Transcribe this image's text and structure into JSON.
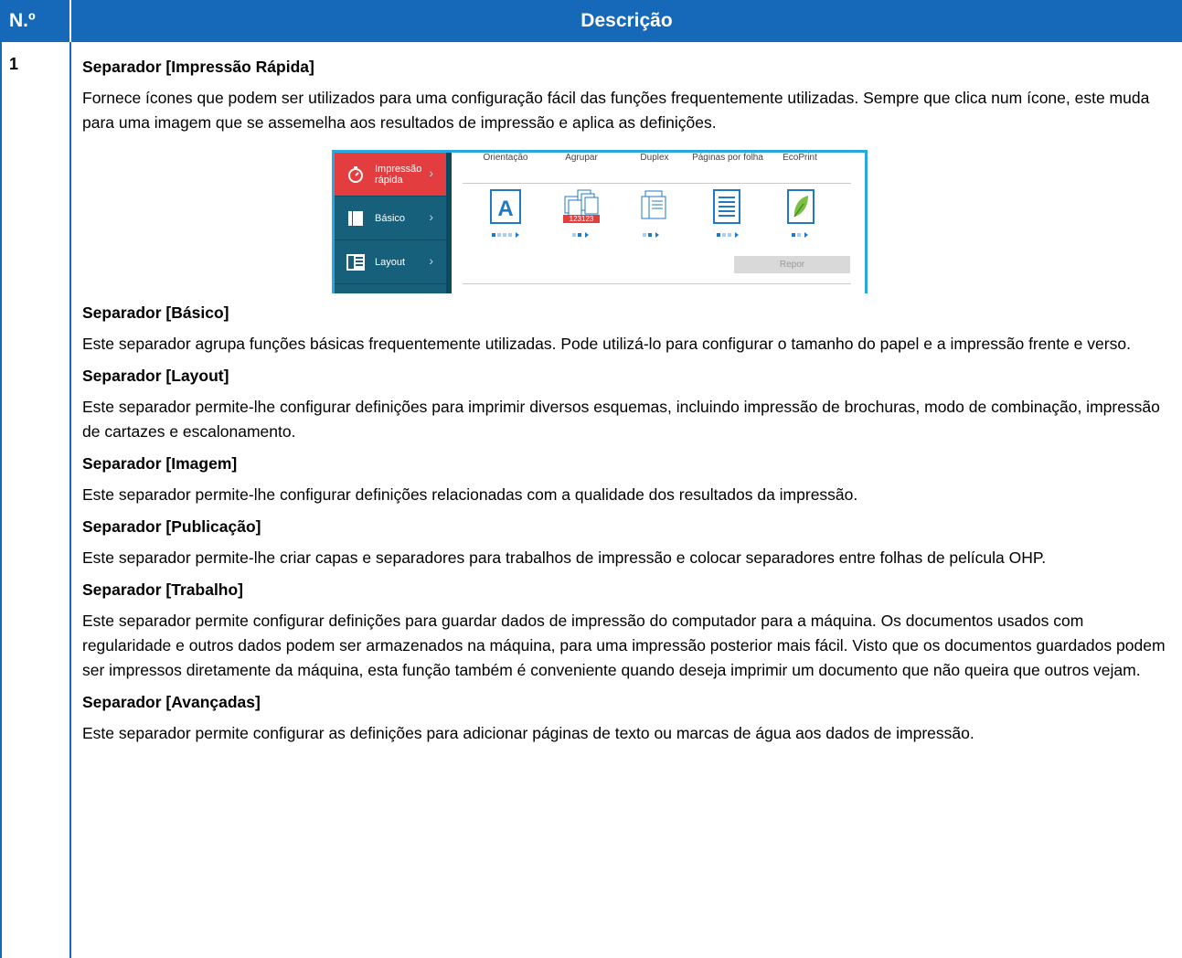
{
  "header": {
    "no": "N.º",
    "desc": "Descrição"
  },
  "row": {
    "no": "1",
    "sections": [
      {
        "title": "Separador [Impressão Rápida]",
        "body": "Fornece ícones que podem ser utilizados para uma configuração fácil das funções frequentemente utilizadas. Sempre que clica num ícone, este muda para uma imagem que se assemelha aos resultados de impressão e aplica as definições."
      },
      {
        "title": "Separador [Básico]",
        "body": "Este separador agrupa funções básicas frequentemente utilizadas. Pode utilizá-lo para configurar o tamanho do papel e a impressão frente e verso."
      },
      {
        "title": "Separador [Layout]",
        "body": "Este separador permite-lhe configurar definições para imprimir diversos esquemas, incluindo impressão de brochuras, modo de combinação, impressão de cartazes e escalonamento."
      },
      {
        "title": "Separador [Imagem]",
        "body": "Este separador permite-lhe configurar definições relacionadas com a qualidade dos resultados da impressão."
      },
      {
        "title": "Separador [Publicação]",
        "body": "Este separador permite-lhe criar capas e separadores para trabalhos de impressão e colocar separadores entre folhas de película OHP."
      },
      {
        "title": "Separador [Trabalho]",
        "body": "Este separador permite configurar definições para guardar dados de impressão do computador para a máquina. Os documentos usados com regularidade e outros dados podem ser armazenados na máquina, para uma impressão posterior mais fácil. Visto que os documentos guardados podem ser impressos diretamente da máquina, esta função também é conveniente quando deseja imprimir um documento que não queira que outros vejam."
      },
      {
        "title": "Separador [Avançadas]",
        "body": "Este separador permite configurar as definições para adicionar páginas de texto ou marcas de água aos dados de impressão."
      }
    ]
  },
  "screenshot": {
    "side_items": [
      {
        "label": "Impressão rápida",
        "icon": "stopwatch-icon",
        "active": true
      },
      {
        "label": "Básico",
        "icon": "book-icon",
        "active": false
      },
      {
        "label": "Layout",
        "icon": "layout-grid-icon",
        "active": false
      }
    ],
    "options": [
      "Orientação",
      "Agrupar",
      "Duplex",
      "Páginas por folha",
      "EcoPrint"
    ],
    "option_icons": [
      "letter-a-icon",
      "collate-pages-icon",
      "duplex-pages-icon",
      "pages-per-sheet-icon",
      "eco-leaf-icon"
    ],
    "collate_text": "123123",
    "reset_label": "Repor",
    "colors": {
      "accent": "#1668b8",
      "sidebar": "#16607c",
      "active": "#e43d3f",
      "border": "#28a8e0"
    }
  }
}
